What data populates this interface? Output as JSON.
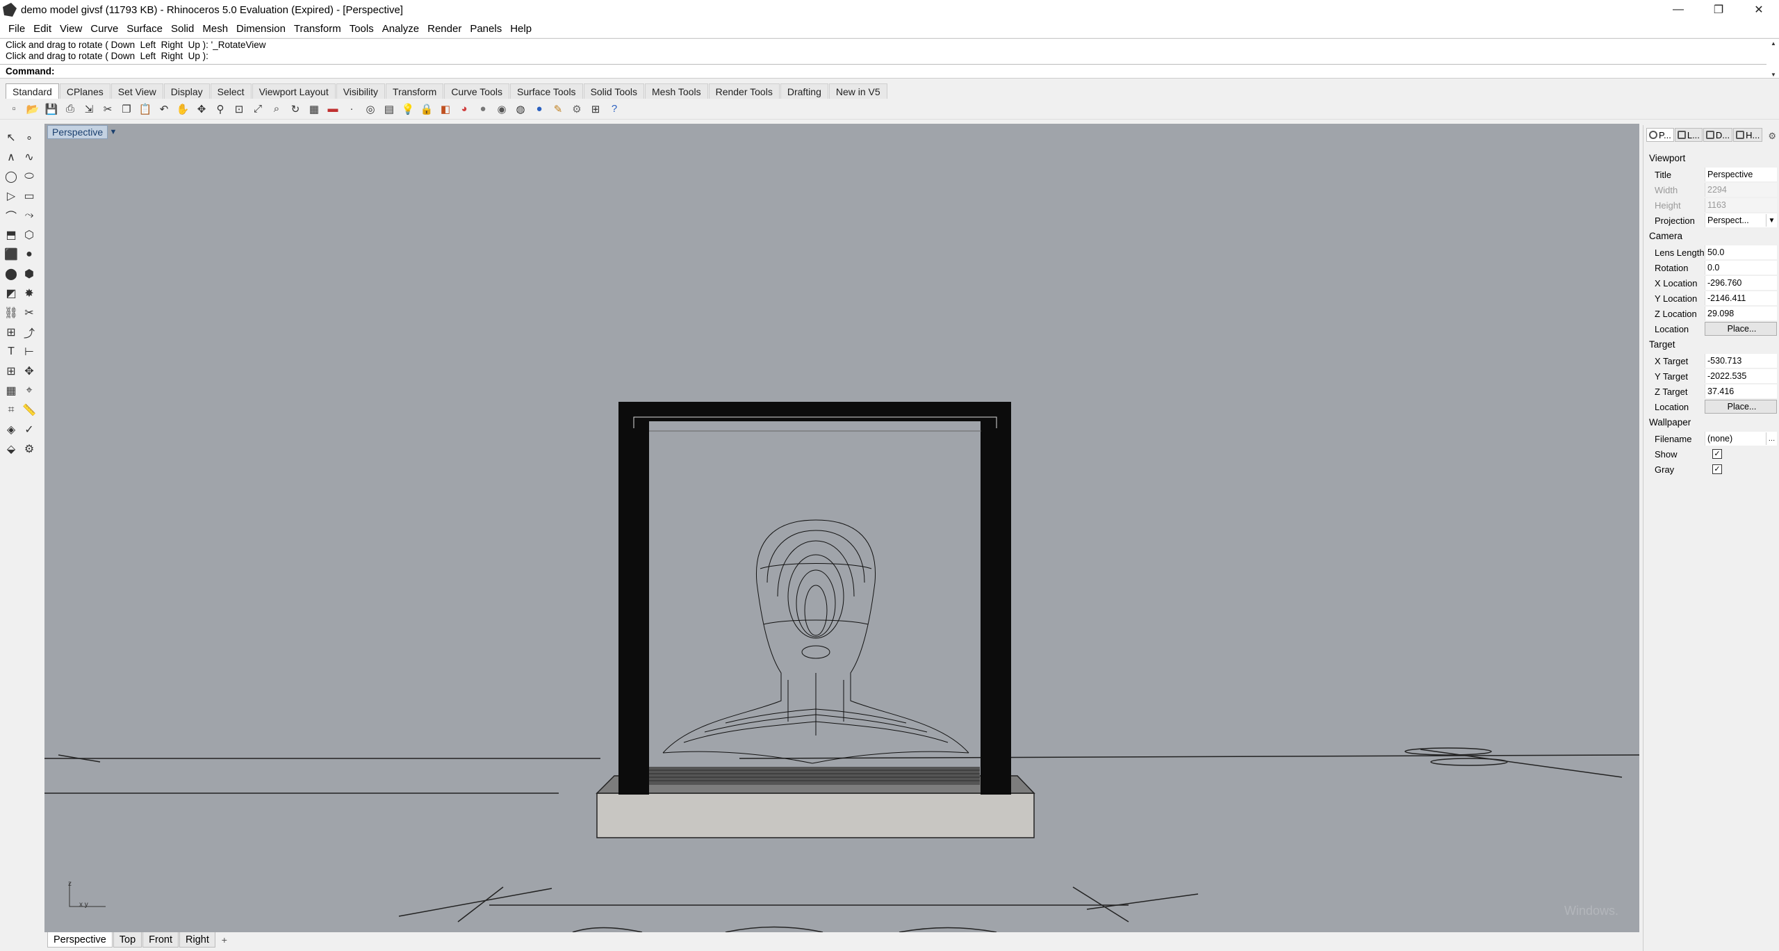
{
  "window": {
    "title": "demo model givsf (11793 KB) - Rhinoceros 5.0 Evaluation (Expired) - [Perspective]",
    "minimize": "—",
    "maximize": "❐",
    "close": "✕"
  },
  "menu": [
    "File",
    "Edit",
    "View",
    "Curve",
    "Surface",
    "Solid",
    "Mesh",
    "Dimension",
    "Transform",
    "Tools",
    "Analyze",
    "Render",
    "Panels",
    "Help"
  ],
  "command": {
    "history": [
      "Click and drag to rotate ( Down  Left  Right  Up ): '_RotateView",
      "Click and drag to rotate ( Down  Left  Right  Up ):"
    ],
    "prompt_label": "Command:",
    "input_value": ""
  },
  "toolbar_tabs": [
    "Standard",
    "CPlanes",
    "Set View",
    "Display",
    "Select",
    "Viewport Layout",
    "Visibility",
    "Transform",
    "Curve Tools",
    "Surface Tools",
    "Solid Tools",
    "Mesh Tools",
    "Render Tools",
    "Drafting",
    "New in V5"
  ],
  "toolbar_icons": [
    "new-file-icon",
    "open-icon",
    "save-icon",
    "print-icon",
    "import-icon",
    "cut-icon",
    "copy-icon",
    "paste-icon",
    "undo-icon",
    "pan-icon",
    "move-view-icon",
    "zoom-icon",
    "zoom-window-icon",
    "zoom-extents-icon",
    "zoom-selected-icon",
    "rotate-view-icon",
    "grid-icon",
    "car-icon",
    "point-icon",
    "target-icon",
    "layer-icon",
    "light-bulb-icon",
    "lock-icon",
    "material-icon",
    "color-wheel-icon",
    "sphere-icon",
    "render-sphere-icon",
    "env-sphere-icon",
    "blue-sphere-icon",
    "brush-icon",
    "settings-gear-icon",
    "options-icon",
    "help-icon"
  ],
  "viewport": {
    "label": "Perspective",
    "watermark": "Windows."
  },
  "viewport_tabs": [
    "Perspective",
    "Top",
    "Front",
    "Right"
  ],
  "panel": {
    "tabs": [
      "P...",
      "L...",
      "D...",
      "H..."
    ],
    "viewport_section": "Viewport",
    "title_label": "Title",
    "title_value": "Perspective",
    "width_label": "Width",
    "width_value": "2294",
    "height_label": "Height",
    "height_value": "1163",
    "projection_label": "Projection",
    "projection_value": "Perspect...",
    "camera_section": "Camera",
    "lens_label": "Lens Length",
    "lens_value": "50.0",
    "rotation_label": "Rotation",
    "rotation_value": "0.0",
    "xloc_label": "X Location",
    "xloc_value": "-296.760",
    "yloc_label": "Y Location",
    "yloc_value": "-2146.411",
    "zloc_label": "Z Location",
    "zloc_value": "29.098",
    "location_label": "Location",
    "place_label": "Place...",
    "target_section": "Target",
    "xtarget_label": "X Target",
    "xtarget_value": "-530.713",
    "ytarget_label": "Y Target",
    "ytarget_value": "-2022.535",
    "ztarget_label": "Z Target",
    "ztarget_value": "37.416",
    "target_location_label": "Location",
    "target_place_label": "Place...",
    "wallpaper_section": "Wallpaper",
    "filename_label": "Filename",
    "filename_value": "(none)",
    "show_label": "Show",
    "gray_label": "Gray"
  },
  "axis_labels": {
    "z": "z",
    "xy": "x y"
  }
}
